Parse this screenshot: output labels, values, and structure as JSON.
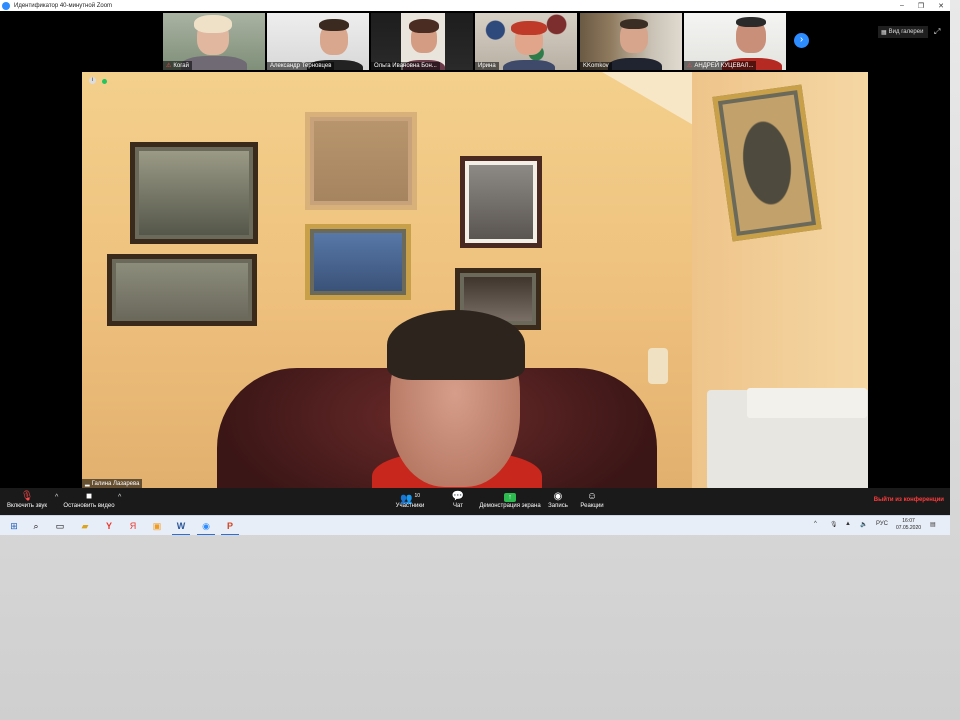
{
  "window": {
    "title": "Идентификатор 40-минутной Zoom",
    "minimize": "–",
    "maximize": "❐",
    "close": "✕"
  },
  "gallery": {
    "label": "Вид галереи",
    "fullscreen": "⤢",
    "next": "›"
  },
  "participants": [
    {
      "name": "Когай",
      "muted": true
    },
    {
      "name": "Александр Терновцев",
      "muted": false
    },
    {
      "name": "Ольга Ивановна Бон...",
      "muted": false
    },
    {
      "name": "Ирина",
      "muted": false
    },
    {
      "name": "KKomkov",
      "muted": false
    },
    {
      "name": "АНДРЕЙ КУЦЕВАЛ...",
      "muted": true
    }
  ],
  "speaker": {
    "name": "Галина Лазарева"
  },
  "toolbar": {
    "unmute": "Включить звук",
    "stop_video": "Остановить видео",
    "participants": "Участники",
    "participants_count": "10",
    "chat": "Чат",
    "share": "Демонстрация экрана",
    "record": "Запись",
    "reactions": "Реакции",
    "leave": "Выйти из конференции"
  },
  "taskbar": {
    "language": "РУС",
    "time": "16:07",
    "date": "07.05.2020"
  },
  "colors": {
    "accent": "#2d8cff",
    "leave": "#ff3b3b",
    "share": "#2dba4e"
  }
}
